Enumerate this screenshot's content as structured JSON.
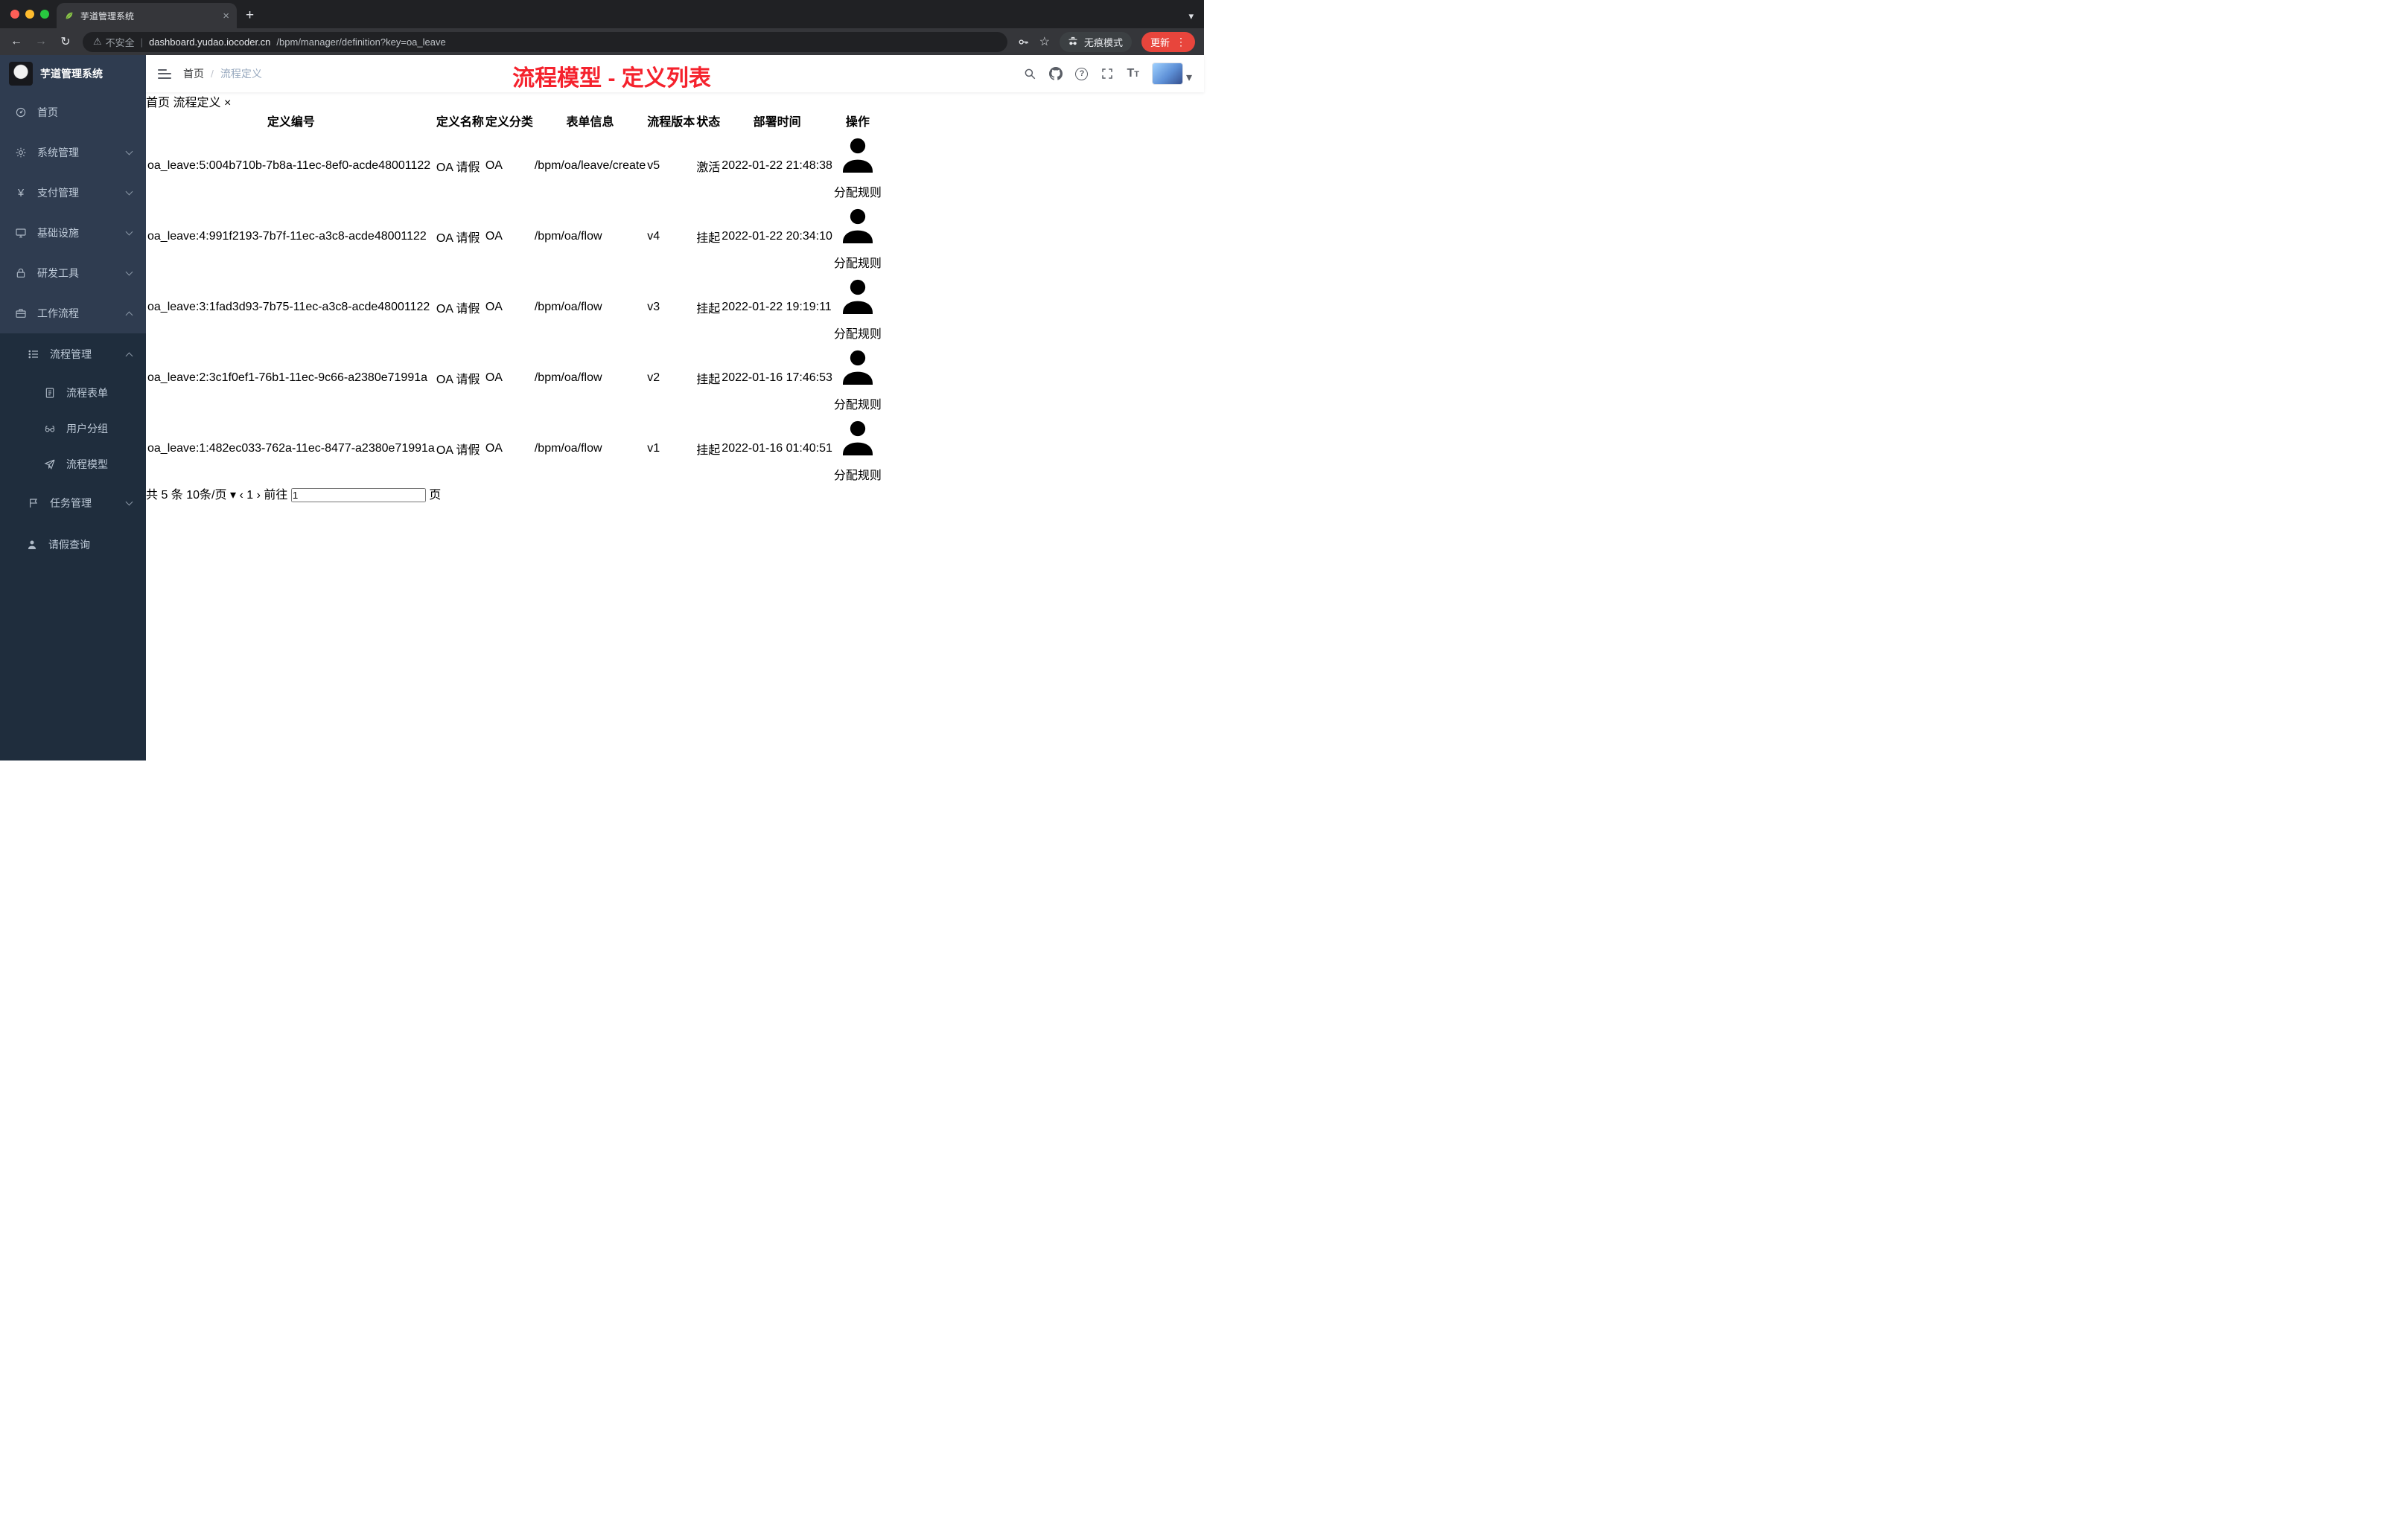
{
  "colors": {
    "accent": "#409EFF",
    "success": "#67C23A",
    "warning": "#E6A23C",
    "annotation_red": "#F5222D",
    "sidebar_bg": "#2F3C50",
    "submenu_bg": "#1F2D3D",
    "chrome_bg": "#202124",
    "toolbar_bg": "#35363A"
  },
  "browser": {
    "tab_title": "芋道管理系统",
    "security_label": "不安全",
    "url_host": "dashboard.yudao.iocoder.cn",
    "url_path": "/bpm/manager/definition?key=oa_leave",
    "incognito_label": "无痕模式",
    "update_label": "更新"
  },
  "glyphs": {
    "new_tab": "+",
    "tab_close": "×",
    "tab_search": "▾",
    "back": "←",
    "forward": "→",
    "reload": "↻",
    "warning": "⚠",
    "divider": "|",
    "star": "☆",
    "kebab": "⋮",
    "question": "?",
    "font_large": "T",
    "font_small": "T",
    "avatar_caret": "▾",
    "select_caret": "▾",
    "prev": "‹",
    "next": "›",
    "tag_dot": "",
    "tag_close": "×"
  },
  "sidebar": {
    "logo_title": "芋道管理系统",
    "menu": [
      "首页",
      "系统管理",
      "支付管理",
      "基础设施",
      "研发工具",
      "工作流程"
    ],
    "process_group": "流程管理",
    "process_children": [
      "流程表单",
      "用户分组",
      "流程模型"
    ],
    "task_group": "任务管理",
    "leave_item": "请假查询"
  },
  "header": {
    "breadcrumb_home": "首页",
    "breadcrumb_sep": "/",
    "breadcrumb_current": "流程定义",
    "annotation": "流程模型 - 定义列表"
  },
  "tags": {
    "home": "首页",
    "active": "流程定义"
  },
  "table": {
    "columns": [
      "定义编号",
      "定义名称",
      "定义分类",
      "表单信息",
      "流程版本",
      "状态",
      "部署时间",
      "操作"
    ],
    "action_label": "分配规则",
    "rows": [
      {
        "id": "oa_leave:5:004b710b-7b8a-11ec-8ef0-acde48001122",
        "name": "OA 请假",
        "category": "OA",
        "form": "/bpm/oa/leave/create",
        "version": "v5",
        "status": "激活",
        "time": "2022-01-22 21:48:38"
      },
      {
        "id": "oa_leave:4:991f2193-7b7f-11ec-a3c8-acde48001122",
        "name": "OA 请假",
        "category": "OA",
        "form": "/bpm/oa/flow",
        "version": "v4",
        "status": "挂起",
        "time": "2022-01-22 20:34:10"
      },
      {
        "id": "oa_leave:3:1fad3d93-7b75-11ec-a3c8-acde48001122",
        "name": "OA 请假",
        "category": "OA",
        "form": "/bpm/oa/flow",
        "version": "v3",
        "status": "挂起",
        "time": "2022-01-22 19:19:11"
      },
      {
        "id": "oa_leave:2:3c1f0ef1-76b1-11ec-9c66-a2380e71991a",
        "name": "OA 请假",
        "category": "OA",
        "form": "/bpm/oa/flow",
        "version": "v2",
        "status": "挂起",
        "time": "2022-01-16 17:46:53"
      },
      {
        "id": "oa_leave:1:482ec033-762a-11ec-8477-a2380e71991a",
        "name": "OA 请假",
        "category": "OA",
        "form": "/bpm/oa/flow",
        "version": "v1",
        "status": "挂起",
        "time": "2022-01-16 01:40:51"
      }
    ]
  },
  "pagination": {
    "total": "共 5 条",
    "page_size": "10条/页",
    "current": "1",
    "goto_label": "前往",
    "goto_value": "1",
    "goto_unit": "页"
  }
}
